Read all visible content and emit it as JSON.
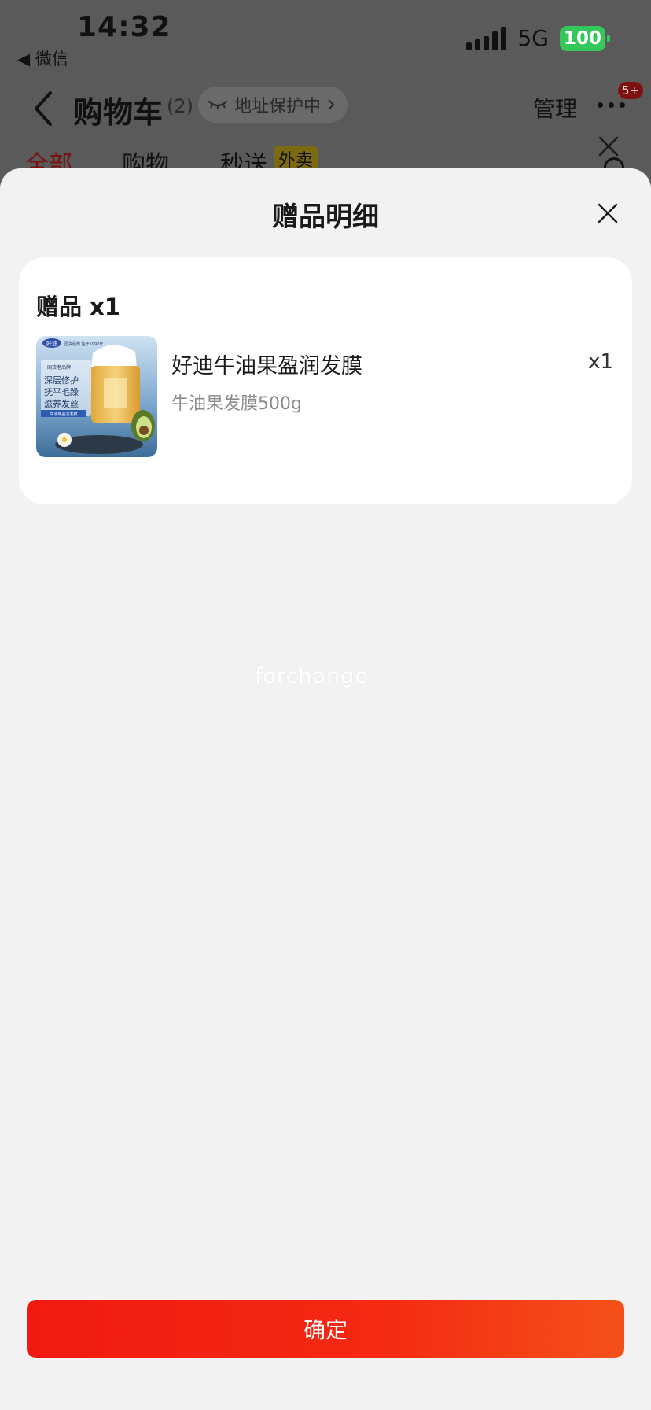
{
  "status_bar": {
    "time": "14:32",
    "back_app": "◀ 微信",
    "network": "5G",
    "battery": "100"
  },
  "cart_header": {
    "title": "购物车",
    "count": "(2)",
    "address_pill": "地址保护中",
    "manage": "管理",
    "more_badge": "5+"
  },
  "tabs": [
    {
      "label": "全部"
    },
    {
      "label": "购物"
    },
    {
      "label": "秒送"
    }
  ],
  "tab_badge": "外卖",
  "sheet": {
    "title": "赠品明细",
    "gift_heading": "赠品 x1",
    "gift": {
      "name": "好迪牛油果盈润发膜",
      "spec": "牛油果发膜500g",
      "qty": "x1",
      "image_text": {
        "brand": "好迪",
        "tagline": "国货经典 始于1992年",
        "tag": "国货老品牌",
        "lines": [
          "深层修护",
          "抚平毛躁",
          "滋养发丝"
        ],
        "strip": "牛油果盈润发膜"
      }
    },
    "watermark": "forchange",
    "confirm": "确定"
  },
  "colors": {
    "accent_red": "#f01a11",
    "battery_green": "#34c759",
    "sheet_bg": "#f2f2f2"
  }
}
